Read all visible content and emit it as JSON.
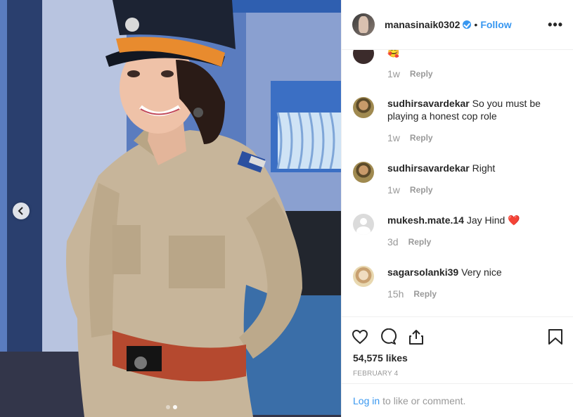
{
  "post": {
    "username": "manasinaik0302",
    "separator": "•",
    "follow_label": "Follow",
    "more_label": "•••"
  },
  "comments": [
    {
      "username": "",
      "text": "🥰",
      "time": "1w",
      "reply": "Reply",
      "avatar": "dark-profile-avatar"
    },
    {
      "username": "sudhirsavardekar",
      "text": "So you must be playing a honest cop role",
      "time": "1w",
      "reply": "Reply",
      "avatar": "man-avatar"
    },
    {
      "username": "sudhirsavardekar",
      "text": "Right",
      "time": "1w",
      "reply": "Reply",
      "avatar": "man-avatar"
    },
    {
      "username": "mukesh.mate.14",
      "text": "Jay Hind ❤️",
      "time": "3d",
      "reply": "Reply",
      "avatar": "default-avatar"
    },
    {
      "username": "sagarsolanki39",
      "text": "Very nice",
      "time": "15h",
      "reply": "Reply",
      "avatar": "photo-avatar"
    }
  ],
  "actions": {
    "like_icon": "heart-icon",
    "comment_icon": "comment-icon",
    "share_icon": "share-icon",
    "save_icon": "bookmark-icon"
  },
  "likes": "54,575 likes",
  "date": "FEBRUARY 4",
  "login": {
    "link": "Log in",
    "text": "to like or comment."
  },
  "colors": {
    "accent": "#3897f0",
    "muted": "#999999",
    "text": "#262626",
    "border": "#efefef"
  }
}
